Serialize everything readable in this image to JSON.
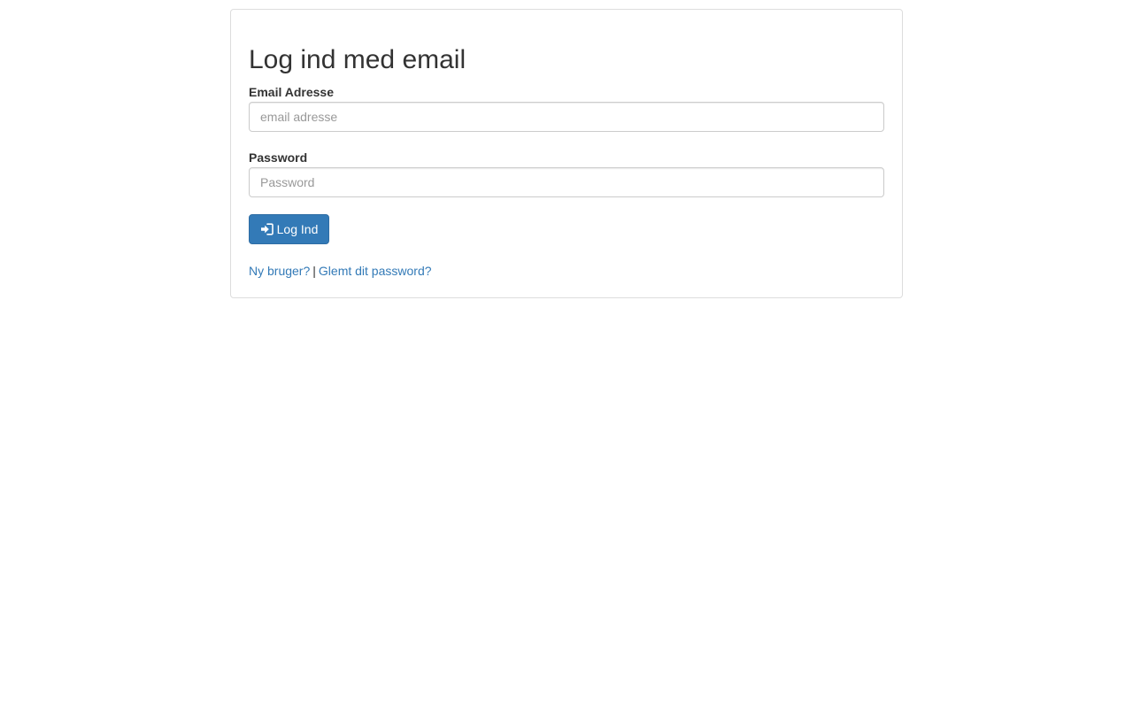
{
  "login_form": {
    "title": "Log ind med email",
    "email_label": "Email Adresse",
    "email_placeholder": "email adresse",
    "email_value": "",
    "password_label": "Password",
    "password_placeholder": "Password",
    "password_value": "",
    "submit_label": "Log Ind",
    "submit_icon": "sign-in-icon",
    "accent_color": "#337ab7"
  },
  "footer_links": {
    "new_user": "Ny bruger?",
    "separator": "|",
    "forgot_password": "Glemt dit password?"
  }
}
